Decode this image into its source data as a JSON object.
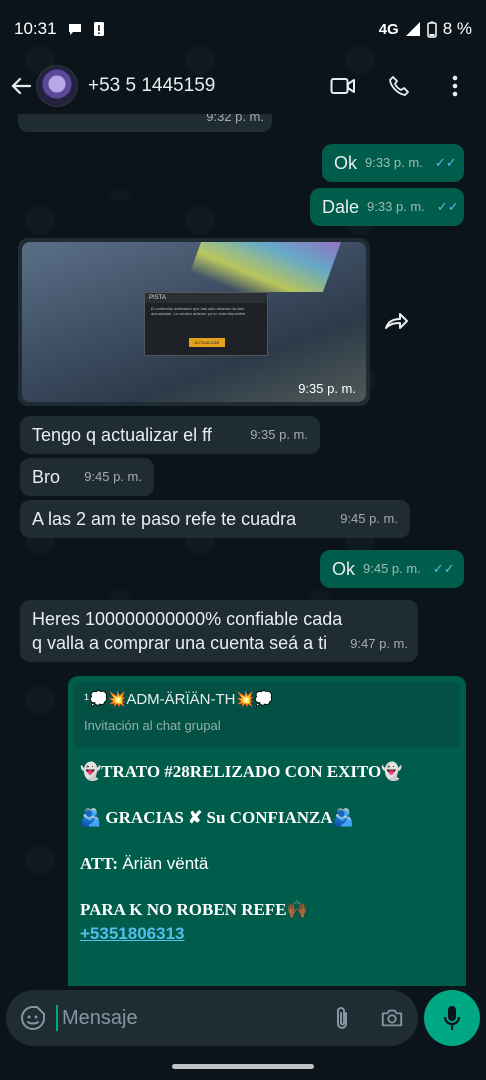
{
  "status_bar": {
    "time": "10:31",
    "network": "4G",
    "battery": "8 %"
  },
  "header": {
    "contact": "+53 5 1445159"
  },
  "messages": [
    {
      "dir": "in",
      "text": "",
      "time": "9:32 p. m."
    },
    {
      "dir": "out",
      "text": "Ok",
      "time": "9:33 p. m."
    },
    {
      "dir": "out",
      "text": "Dale",
      "time": "9:33 p. m."
    },
    {
      "dir": "in",
      "type": "image",
      "time": "9:35 p. m."
    },
    {
      "dir": "in",
      "text": "Tengo q actualizar el ff",
      "time": "9:35 p. m."
    },
    {
      "dir": "in",
      "text": "Bro",
      "time": "9:45 p. m."
    },
    {
      "dir": "in",
      "text": "A las 2 am te paso refe te cuadra",
      "time": "9:45 p. m."
    },
    {
      "dir": "out",
      "text": "Ok",
      "time": "9:45 p. m."
    },
    {
      "dir": "in",
      "text": "Heres 100000000000% confiable cada q valla a comprar una cuenta seá a ti",
      "time": "9:47 p. m."
    }
  ],
  "image_dialog": {
    "title": "PISTA",
    "text": "El contenido detectado que has sido sistema ha sido actualizado. La versión anterior ya no está disponible.",
    "button": "ACTUALIZAR"
  },
  "invite": {
    "group_name": "¹💭💥ADM-ÄRÏÄN-TH💥💭",
    "subtitle": "Invitación al chat grupal",
    "line1": "👻TRATO #28RELIZADO CON EXITO👻",
    "line2": "🫂 GRACIAS ✘ Su CONFIANZA🫂",
    "line3_label": "ATT:",
    "line3_value": "Äriän vëntä",
    "line4": "PARA K NO ROBEN REFE🙌🏾",
    "phone": "+5351806313"
  },
  "input": {
    "placeholder": "Mensaje"
  },
  "colors": {
    "outgoing": "#005c4b",
    "incoming": "#202c33",
    "accent": "#00a884",
    "read_ticks": "#53bdeb"
  },
  "icons": [
    "back-arrow-icon",
    "video-call-icon",
    "phone-icon",
    "more-options-icon",
    "forward-icon",
    "sticker-icon",
    "attach-icon",
    "camera-icon",
    "mic-icon"
  ]
}
